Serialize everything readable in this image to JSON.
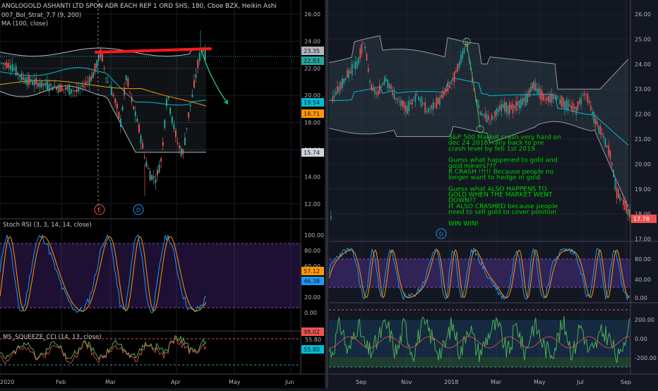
{
  "left": {
    "title": "ANGLOGOLD ASHANTI LTD SPON ADR EACH REP 1 ORD SHS, 180, Cboe BZX, Heikin Ashi",
    "indicator1": "007_Bol_Strat_7.7 (9, 200)",
    "indicator2": "MA (100, close)",
    "price_axis": [
      "26.00",
      "24.00",
      "22.00",
      "20.00",
      "18.00",
      "16.00",
      "14.00",
      "12.00"
    ],
    "price_badges": [
      {
        "text": "23.35",
        "color": "#b2b5be",
        "text_color": "#131722"
      },
      {
        "text": "22.83",
        "color": "#26a69a",
        "text_color": "#131722"
      },
      {
        "text": "19.54",
        "color": "#00bcd4",
        "text_color": "#131722"
      },
      {
        "text": "18.71",
        "color": "#ff9800",
        "text_color": "#131722"
      },
      {
        "text": "15.74",
        "color": "#d1d4dc",
        "text_color": "#131722"
      }
    ],
    "event_markers": [
      "E",
      "D"
    ],
    "stoch_title": "Stoch RSI (3, 3, 14, 14, close)",
    "stoch_axis": [
      "100.00",
      "80.00",
      "60.00",
      "40.00",
      "20.00",
      "0.00"
    ],
    "stoch_badges": [
      {
        "text": "57.12",
        "color": "#ff9800"
      },
      {
        "text": "46.38",
        "color": "#2196f3"
      }
    ],
    "squeeze_title": "MS_SQUEEZE_CCI (14, 13, close)",
    "squeeze_axis": [
      "55.80"
    ],
    "squeeze_badges": [
      {
        "text": "98.02",
        "color": "#ef5350"
      },
      {
        "text": "55.80",
        "color": "#00bcd4"
      }
    ],
    "time_axis": [
      "2020",
      "Feb",
      "Mar",
      "Apr",
      "May",
      "Jun"
    ]
  },
  "right": {
    "price_axis": [
      "26.00",
      "25.00",
      "24.00",
      "23.00",
      "22.00",
      "21.00",
      "20.00",
      "19.00",
      "18.00",
      "17.00"
    ],
    "price_badge": {
      "text": "17.78",
      "color": "#ef5350"
    },
    "annotation": [
      "S&P 500 Market crash very hard on",
      "dec 24 2018, rally back to pre",
      "crash level by feb 1st 2019.",
      "",
      "Guess what happened to gold and",
      "gold miners???",
      "It CRASH !!!!! Because people no",
      "longer want to hedge in gold.",
      "",
      "Guess what ALSO HAPPENS TO",
      "GOLD WHEN THE MARKET WENT",
      "DOWN??",
      "IT ALSO CRASHED because people",
      "need to sell gold to cover position",
      "",
      "WIN WIN!"
    ],
    "event_marker": "D",
    "stoch_axis": [
      "80.00",
      "40.00",
      "0.00"
    ],
    "cci_axis": [
      "200.00",
      "0.00",
      "-200.00"
    ],
    "time_axis": [
      "Sep",
      "Nov",
      "2018",
      "Mar",
      "May",
      "Jul",
      "Sep"
    ]
  },
  "colors": {
    "bull": "#26a69a",
    "bear": "#ef5350",
    "band": "#b2b5be",
    "ma": "#ff9800",
    "basis": "#00bcd4",
    "annotation": "#00ff00",
    "resistance": "#ff1a1a"
  }
}
